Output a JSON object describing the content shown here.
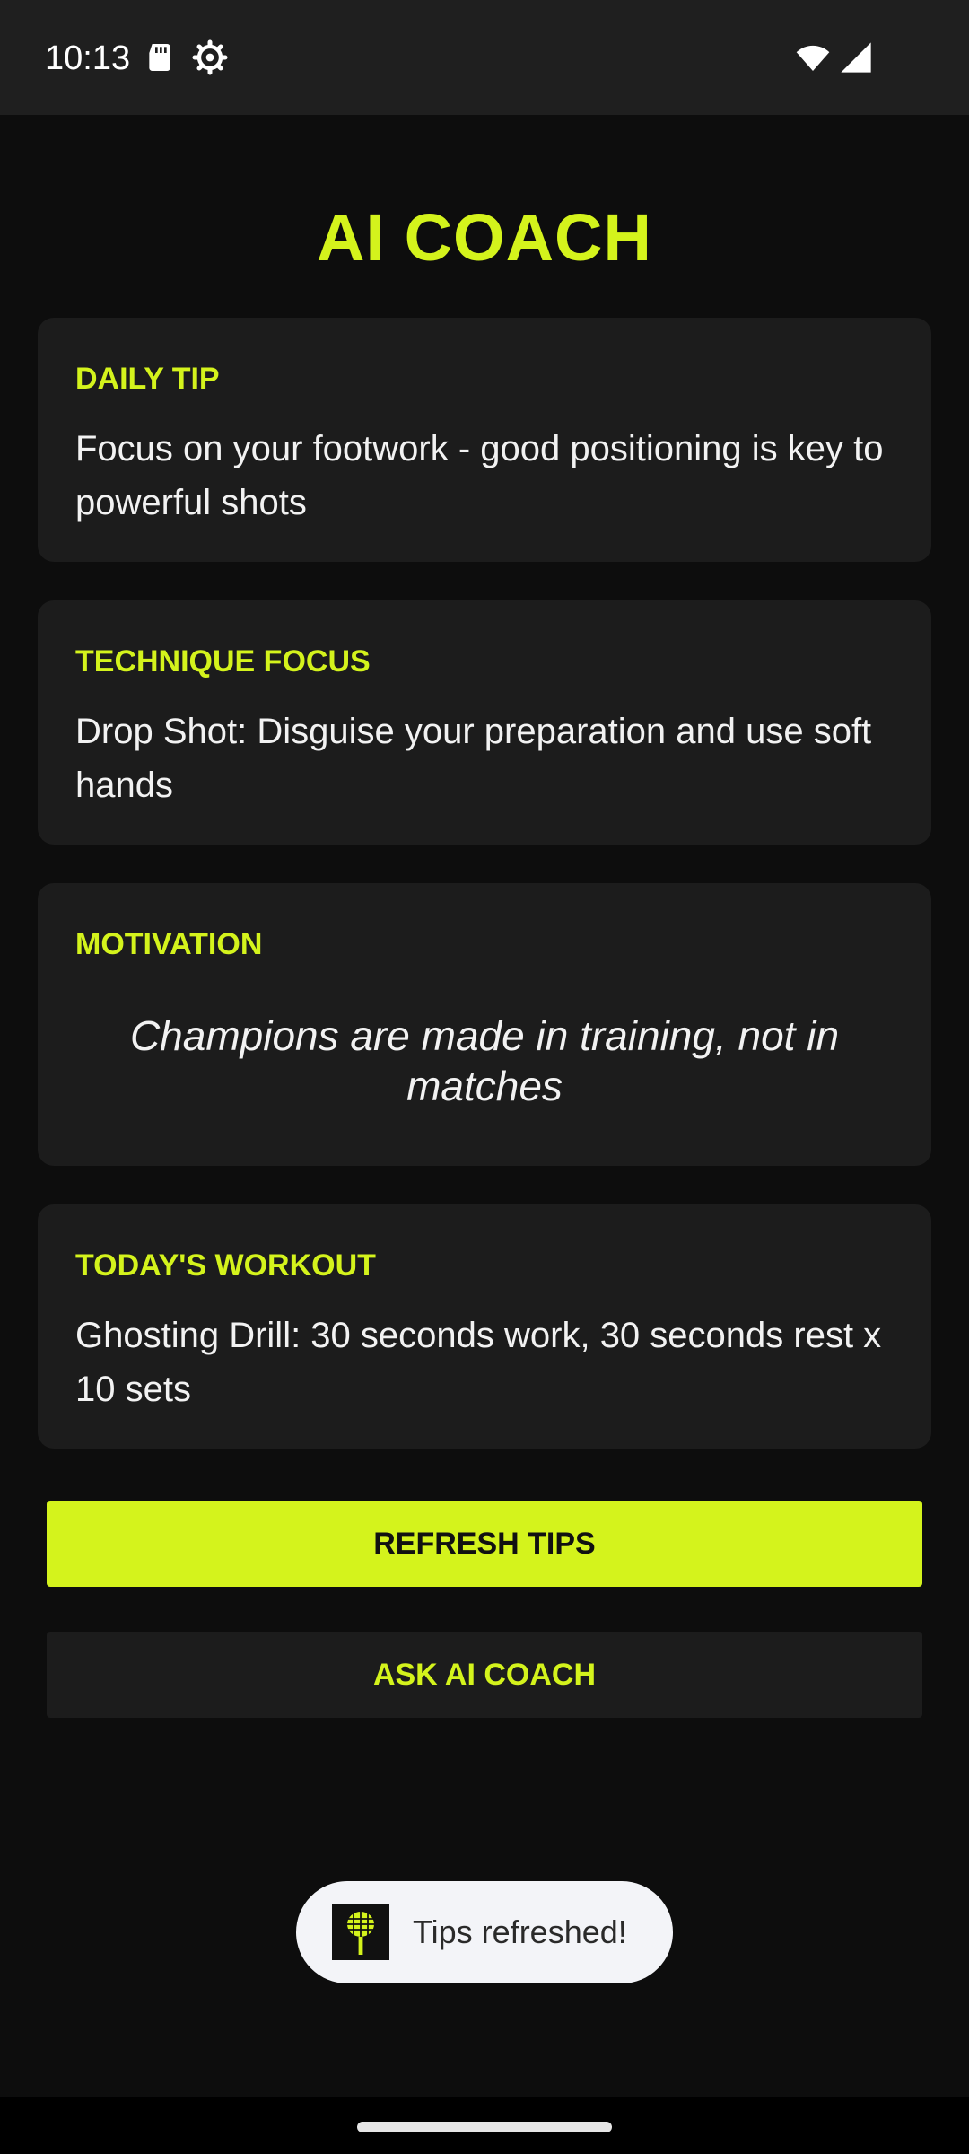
{
  "status_bar": {
    "time": "10:13",
    "icons": [
      "sd-card-icon",
      "settings-icon",
      "wifi-icon",
      "signal-icon"
    ]
  },
  "header": {
    "title": "AI COACH"
  },
  "cards": {
    "daily_tip": {
      "heading": "DAILY TIP",
      "body": "Focus on your footwork - good positioning is key to powerful shots"
    },
    "technique_focus": {
      "heading": "TECHNIQUE FOCUS",
      "body": "Drop Shot: Disguise your preparation and use soft hands"
    },
    "motivation": {
      "heading": "MOTIVATION",
      "quote": "Champions are made in training, not in matches"
    },
    "todays_workout": {
      "heading": "TODAY'S WORKOUT",
      "body": "Ghosting Drill: 30 seconds work, 30 seconds rest x 10 sets"
    }
  },
  "actions": {
    "refresh_label": "REFRESH TIPS",
    "ask_label": "ASK AI COACH"
  },
  "toast": {
    "icon": "racket-app-icon",
    "message": "Tips refreshed!"
  },
  "colors": {
    "background": "#0d0d0d",
    "card": "#1c1c1c",
    "accent": "#d4f31c",
    "status_bar": "#1f1f1f",
    "toast": "#f3f4f8"
  }
}
